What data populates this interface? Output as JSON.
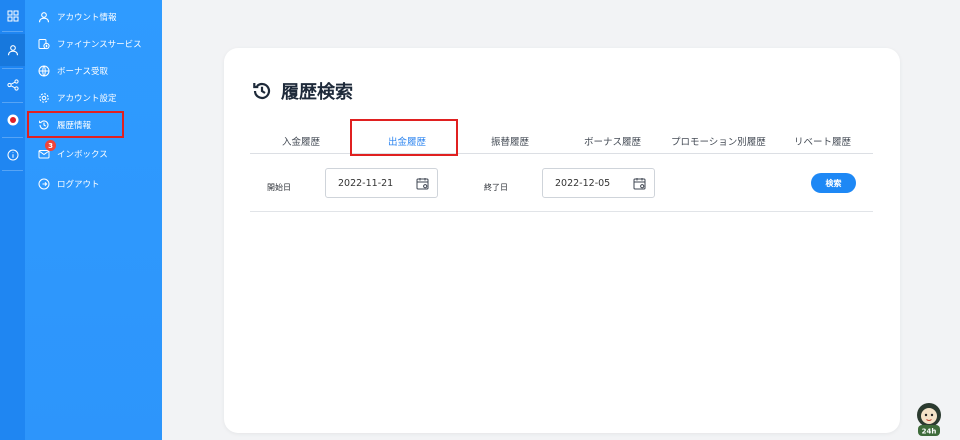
{
  "colors": {
    "rail_bg": "#1f86f2",
    "sidebar_bg": "#2f9bff",
    "accent": "#1e88f5",
    "active_tab": "#2f86f0",
    "highlight": "#e02020",
    "badge": "#f0443a",
    "page_bg": "#f2f3f5"
  },
  "rail": {
    "icons": [
      "grid-icon",
      "user-icon",
      "share-icon",
      "record-icon",
      "info-icon"
    ]
  },
  "sidebar": {
    "items": [
      {
        "label": "アカウント情報",
        "icon": "user-icon"
      },
      {
        "label": "ファイナンスサービス",
        "icon": "finance-icon"
      },
      {
        "label": "ボーナス受取",
        "icon": "bonus-icon"
      },
      {
        "label": "アカウント設定",
        "icon": "gear-icon"
      },
      {
        "label": "履歴情報",
        "icon": "history-icon"
      },
      {
        "label": "インボックス",
        "icon": "inbox-icon"
      },
      {
        "label": "ログアウト",
        "icon": "logout-icon"
      }
    ],
    "inbox_badge": "3"
  },
  "main": {
    "title": "履歴検索",
    "tabs": [
      {
        "label": "入金履歴"
      },
      {
        "label": "出金履歴"
      },
      {
        "label": "振替履歴"
      },
      {
        "label": "ボーナス履歴"
      },
      {
        "label": "プロモーション別履歴"
      },
      {
        "label": "リベート履歴"
      }
    ],
    "active_tab": "出金履歴",
    "filter": {
      "start_label": "開始日",
      "start_value": "2022-11-21",
      "end_label": "終了日",
      "end_value": "2022-12-05",
      "search_label": "検索"
    }
  },
  "mascot": {
    "text": "24h"
  }
}
